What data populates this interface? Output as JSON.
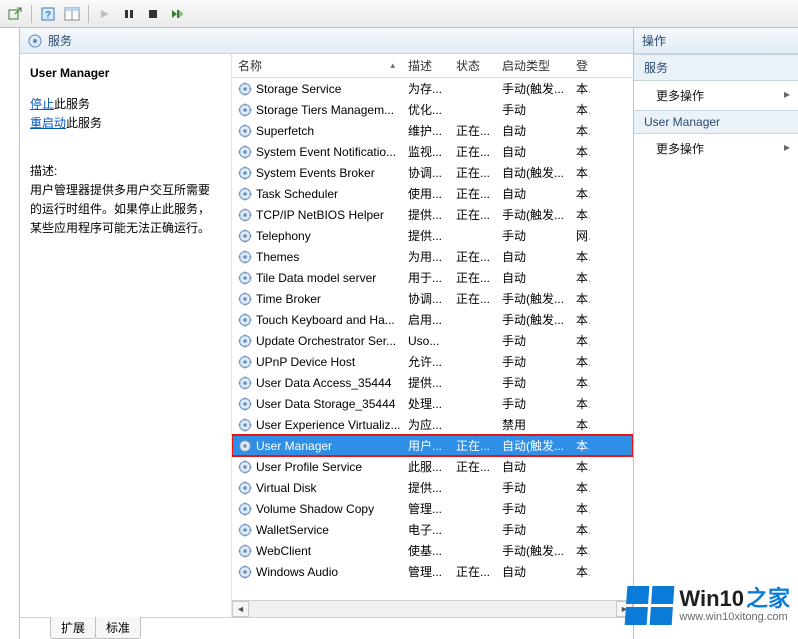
{
  "toolbar": {
    "icons": [
      "export-icon",
      "hr",
      "help-icon",
      "panel-icon",
      "hr",
      "play-icon",
      "pause-icon",
      "stop-icon",
      "restart-icon"
    ]
  },
  "panel": {
    "title": "服务"
  },
  "details": {
    "title": "User Manager",
    "stopLink": "停止",
    "stopSuffix": "此服务",
    "restartLink": "重启动",
    "restartSuffix": "此服务",
    "descLabel": "描述:",
    "descBody": "用户管理器提供多用户交互所需要的运行时组件。如果停止此服务，某些应用程序可能无法正确运行。"
  },
  "columns": {
    "name": "名称",
    "desc": "描述",
    "status": "状态",
    "startType": "启动类型",
    "logon": "登"
  },
  "services": [
    {
      "name": "Storage Service",
      "desc": "为存...",
      "status": "",
      "type": "手动(触发...",
      "logon": "本"
    },
    {
      "name": "Storage Tiers Managem...",
      "desc": "优化...",
      "status": "",
      "type": "手动",
      "logon": "本"
    },
    {
      "name": "Superfetch",
      "desc": "维护...",
      "status": "正在...",
      "type": "自动",
      "logon": "本"
    },
    {
      "name": "System Event Notificatio...",
      "desc": "监视...",
      "status": "正在...",
      "type": "自动",
      "logon": "本"
    },
    {
      "name": "System Events Broker",
      "desc": "协调...",
      "status": "正在...",
      "type": "自动(触发...",
      "logon": "本"
    },
    {
      "name": "Task Scheduler",
      "desc": "使用...",
      "status": "正在...",
      "type": "自动",
      "logon": "本"
    },
    {
      "name": "TCP/IP NetBIOS Helper",
      "desc": "提供...",
      "status": "正在...",
      "type": "手动(触发...",
      "logon": "本"
    },
    {
      "name": "Telephony",
      "desc": "提供...",
      "status": "",
      "type": "手动",
      "logon": "网"
    },
    {
      "name": "Themes",
      "desc": "为用...",
      "status": "正在...",
      "type": "自动",
      "logon": "本"
    },
    {
      "name": "Tile Data model server",
      "desc": "用于...",
      "status": "正在...",
      "type": "自动",
      "logon": "本"
    },
    {
      "name": "Time Broker",
      "desc": "协调...",
      "status": "正在...",
      "type": "手动(触发...",
      "logon": "本"
    },
    {
      "name": "Touch Keyboard and Ha...",
      "desc": "启用...",
      "status": "",
      "type": "手动(触发...",
      "logon": "本"
    },
    {
      "name": "Update Orchestrator Ser...",
      "desc": "Uso...",
      "status": "",
      "type": "手动",
      "logon": "本"
    },
    {
      "name": "UPnP Device Host",
      "desc": "允许...",
      "status": "",
      "type": "手动",
      "logon": "本"
    },
    {
      "name": "User Data Access_35444",
      "desc": "提供...",
      "status": "",
      "type": "手动",
      "logon": "本"
    },
    {
      "name": "User Data Storage_35444",
      "desc": "处理...",
      "status": "",
      "type": "手动",
      "logon": "本"
    },
    {
      "name": "User Experience Virtualiz...",
      "desc": "为应...",
      "status": "",
      "type": "禁用",
      "logon": "本"
    },
    {
      "name": "User Manager",
      "desc": "用户...",
      "status": "正在...",
      "type": "自动(触发...",
      "logon": "本",
      "selected": true,
      "highlight": true
    },
    {
      "name": "User Profile Service",
      "desc": "此服...",
      "status": "正在...",
      "type": "自动",
      "logon": "本"
    },
    {
      "name": "Virtual Disk",
      "desc": "提供...",
      "status": "",
      "type": "手动",
      "logon": "本"
    },
    {
      "name": "Volume Shadow Copy",
      "desc": "管理...",
      "status": "",
      "type": "手动",
      "logon": "本"
    },
    {
      "name": "WalletService",
      "desc": "电子...",
      "status": "",
      "type": "手动",
      "logon": "本"
    },
    {
      "name": "WebClient",
      "desc": "使基...",
      "status": "",
      "type": "手动(触发...",
      "logon": "本"
    },
    {
      "name": "Windows Audio",
      "desc": "管理...",
      "status": "正在...",
      "type": "自动",
      "logon": "本"
    }
  ],
  "tabs": {
    "extended": "扩展",
    "standard": "标准"
  },
  "rightPanel": {
    "header": "操作",
    "group1": "服务",
    "more1": "更多操作",
    "group2": "User Manager",
    "more2": "更多操作"
  },
  "watermark": {
    "brand": "Win10",
    "suffix": "之家",
    "url": "www.win10xitong.com"
  }
}
